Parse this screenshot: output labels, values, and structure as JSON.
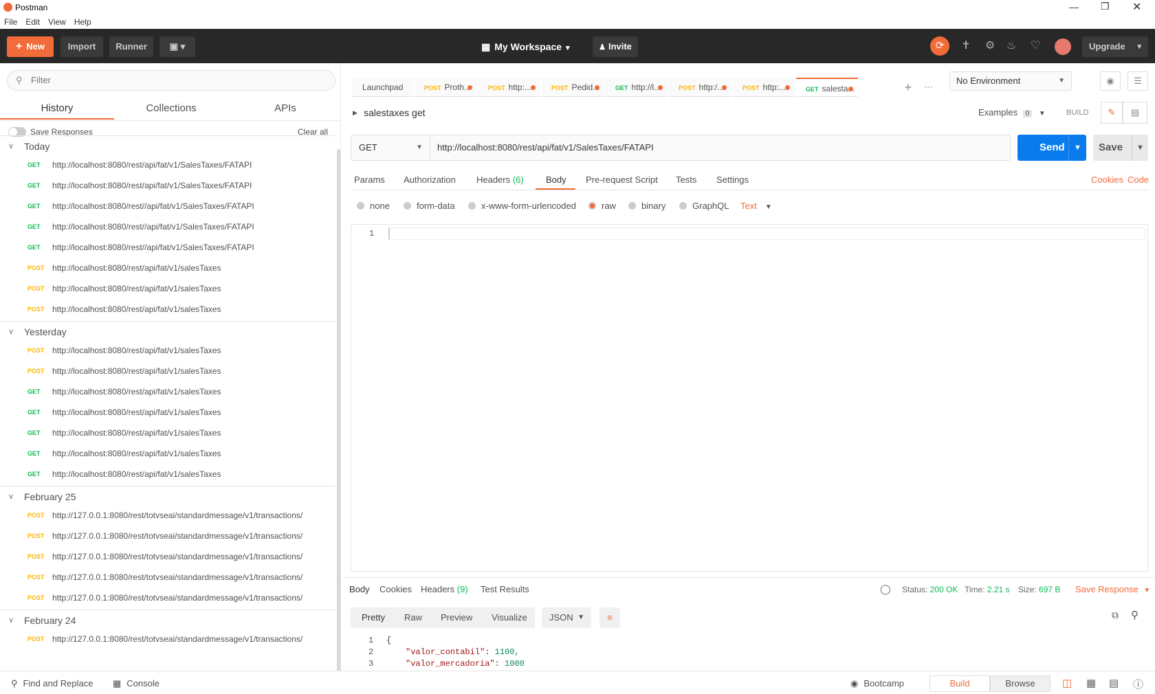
{
  "window": {
    "title": "Postman"
  },
  "menu": [
    "File",
    "Edit",
    "View",
    "Help"
  ],
  "toolbar": {
    "new_label": "New",
    "import_label": "Import",
    "runner_label": "Runner",
    "workspace_label": "My Workspace",
    "invite_label": "Invite",
    "upgrade_label": "Upgrade"
  },
  "sidebar": {
    "filter_placeholder": "Filter",
    "tabs": [
      "History",
      "Collections",
      "APIs"
    ],
    "save_responses_label": "Save Responses",
    "clear_all_label": "Clear all",
    "groups": [
      {
        "label": "Today",
        "items": [
          {
            "method": "GET",
            "url": "http://localhost:8080/rest/api/fat/v1/SalesTaxes/FATAPI"
          },
          {
            "method": "GET",
            "url": "http://localhost:8080/rest/api/fat/v1/SalesTaxes/FATAPI"
          },
          {
            "method": "GET",
            "url": "http://localhost:8080/rest//api/fat/v1/SalesTaxes/FATAPI"
          },
          {
            "method": "GET",
            "url": "http://localhost:8080/rest//api/fat/v1/SalesTaxes/FATAPI"
          },
          {
            "method": "GET",
            "url": "http://localhost:8080/rest//api/fat/v1/SalesTaxes/FATAPI"
          },
          {
            "method": "POST",
            "url": "http://localhost:8080/rest/api/fat/v1/salesTaxes"
          },
          {
            "method": "POST",
            "url": "http://localhost:8080/rest/api/fat/v1/salesTaxes"
          },
          {
            "method": "POST",
            "url": "http://localhost:8080/rest/api/fat/v1/salesTaxes"
          }
        ]
      },
      {
        "label": "Yesterday",
        "items": [
          {
            "method": "POST",
            "url": "http://localhost:8080/rest/api/fat/v1/salesTaxes"
          },
          {
            "method": "POST",
            "url": "http://localhost:8080/rest/api/fat/v1/salesTaxes"
          },
          {
            "method": "GET",
            "url": "http://localhost:8080/rest/api/fat/v1/salesTaxes"
          },
          {
            "method": "GET",
            "url": "http://localhost:8080/rest/api/fat/v1/salesTaxes"
          },
          {
            "method": "GET",
            "url": "http://localhost:8080/rest/api/fat/v1/salesTaxes"
          },
          {
            "method": "GET",
            "url": "http://localhost:8080/rest/api/fat/v1/salesTaxes"
          },
          {
            "method": "GET",
            "url": "http://localhost:8080/rest/api/fat/v1/salesTaxes"
          }
        ]
      },
      {
        "label": "February 25",
        "items": [
          {
            "method": "POST",
            "url": "http://127.0.0.1:8080/rest/totvseai/standardmessage/v1/transactions/"
          },
          {
            "method": "POST",
            "url": "http://127.0.0.1:8080/rest/totvseai/standardmessage/v1/transactions/"
          },
          {
            "method": "POST",
            "url": "http://127.0.0.1:8080/rest/totvseai/standardmessage/v1/transactions/"
          },
          {
            "method": "POST",
            "url": "http://127.0.0.1:8080/rest/totvseai/standardmessage/v1/transactions/"
          },
          {
            "method": "POST",
            "url": "http://127.0.0.1:8080/rest/totvseai/standardmessage/v1/transactions/"
          }
        ]
      },
      {
        "label": "February 24",
        "items": [
          {
            "method": "POST",
            "url": "http://127.0.0.1:8080/rest/totvseai/standardmessage/v1/transactions/"
          }
        ]
      }
    ]
  },
  "tabs": [
    {
      "method": "",
      "label": "Launchpad"
    },
    {
      "method": "POST",
      "label": "Proth..."
    },
    {
      "method": "POST",
      "label": "http:..."
    },
    {
      "method": "POST",
      "label": "Pedid..."
    },
    {
      "method": "GET",
      "label": "http://l..."
    },
    {
      "method": "POST",
      "label": "http:/..."
    },
    {
      "method": "POST",
      "label": "http:..."
    },
    {
      "method": "GET",
      "label": "salesta..."
    }
  ],
  "environment": {
    "label": "No Environment"
  },
  "request": {
    "name": "salestaxes get",
    "examples_label": "Examples",
    "examples_count": "0",
    "build_label": "BUILD",
    "method": "GET",
    "url": "http://localhost:8080/rest/api/fat/v1/SalesTaxes/FATAPI",
    "send_label": "Send",
    "save_label": "Save",
    "subtabs": [
      "Params",
      "Authorization",
      "Headers",
      "Body",
      "Pre-request Script",
      "Tests",
      "Settings"
    ],
    "headers_count": "(6)",
    "cookies_label": "Cookies",
    "code_label": "Code",
    "body_modes": [
      "none",
      "form-data",
      "x-www-form-urlencoded",
      "raw",
      "binary",
      "GraphQL"
    ],
    "body_format": "Text",
    "editor_line": "1"
  },
  "response": {
    "tabs": [
      "Body",
      "Cookies",
      "Headers",
      "Test Results"
    ],
    "headers_count": "(9)",
    "status_label": "Status:",
    "status_value": "200 OK",
    "time_label": "Time:",
    "time_value": "2.21 s",
    "size_label": "Size:",
    "size_value": "697 B",
    "save_response_label": "Save Response",
    "view_modes": [
      "Pretty",
      "Raw",
      "Preview",
      "Visualize"
    ],
    "format": "JSON",
    "lines": [
      {
        "n": "1",
        "text": "{"
      },
      {
        "n": "2",
        "key": "\"valor_contabil\"",
        "value": "1100,"
      },
      {
        "n": "3",
        "key": "\"valor_mercadoria\"",
        "value": "1000"
      }
    ]
  },
  "statusbar": {
    "find_replace_label": "Find and Replace",
    "console_label": "Console",
    "bootcamp_label": "Bootcamp",
    "build_label": "Build",
    "browse_label": "Browse"
  },
  "colors": {
    "accent": "#f26b3a",
    "send": "#097bed",
    "get": "#0cbb52",
    "post": "#ffb400"
  }
}
